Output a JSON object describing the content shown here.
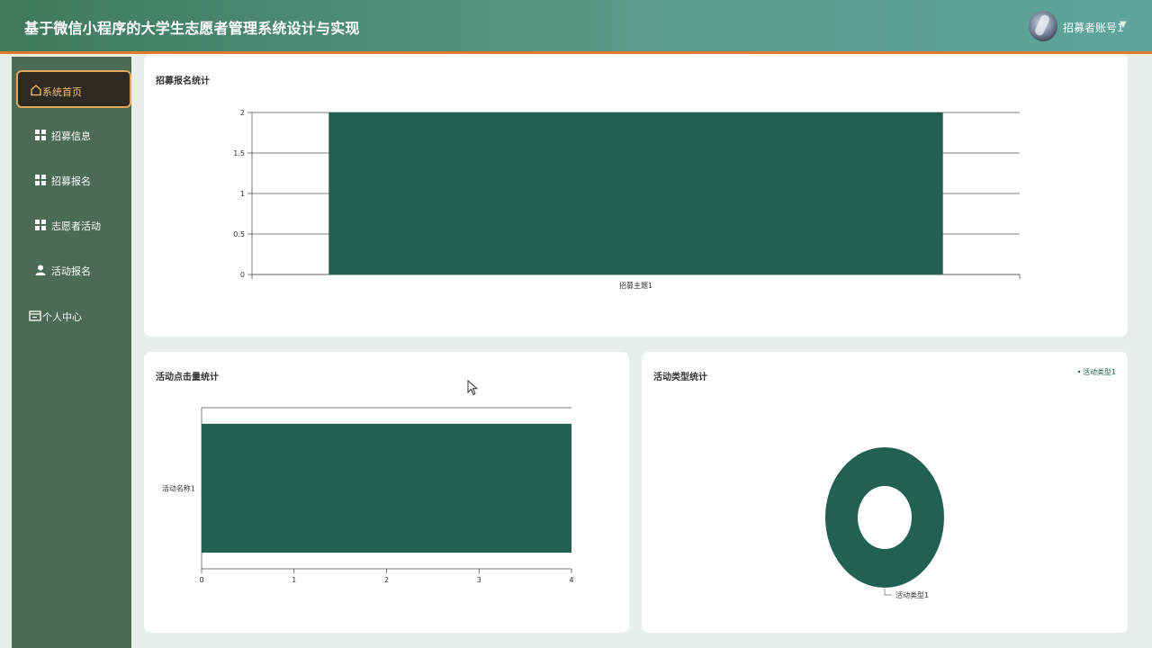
{
  "header": {
    "title": "基于微信小程序的大学生志愿者管理系统设计与实现",
    "account": "招募者账号1",
    "caret": "▼"
  },
  "sidebar": {
    "items": [
      {
        "label": "系统首页",
        "icon": "home-icon",
        "active": true
      },
      {
        "label": "招募信息",
        "icon": "grid-icon",
        "active": false
      },
      {
        "label": "招募报名",
        "icon": "grid-icon",
        "active": false
      },
      {
        "label": "志愿者活动",
        "icon": "grid-icon",
        "active": false
      },
      {
        "label": "活动报名",
        "icon": "user-icon",
        "active": false
      },
      {
        "label": "个人中心",
        "icon": "id-card-icon",
        "active": false
      }
    ]
  },
  "colors": {
    "accent": "#22604f",
    "active_border": "#e2a85a",
    "header_border": "#e07a2c"
  },
  "cards": {
    "recruit_stats": {
      "title": "招募报名统计"
    },
    "activity_clicks": {
      "title": "活动点击量统计"
    },
    "activity_types": {
      "title": "活动类型统计"
    }
  },
  "chart_data": [
    {
      "type": "bar",
      "title": "招募报名统计",
      "categories": [
        "招募主题1"
      ],
      "values": [
        2
      ],
      "ylim": [
        0,
        2
      ],
      "yticks": [
        "0",
        "0.5",
        "1",
        "1.5",
        "2"
      ],
      "grid": true
    },
    {
      "type": "bar",
      "orientation": "horizontal",
      "title": "活动点击量统计",
      "categories": [
        "活动名称1"
      ],
      "values": [
        4
      ],
      "xlim": [
        0,
        4
      ],
      "xticks": [
        "0",
        "1",
        "2",
        "3",
        "4"
      ]
    },
    {
      "type": "pie",
      "donut": true,
      "title": "活动类型统计",
      "labels": [
        "活动类型1"
      ],
      "values": [
        1
      ],
      "legend": [
        "活动类型1"
      ],
      "legend_position": "top-right"
    }
  ]
}
